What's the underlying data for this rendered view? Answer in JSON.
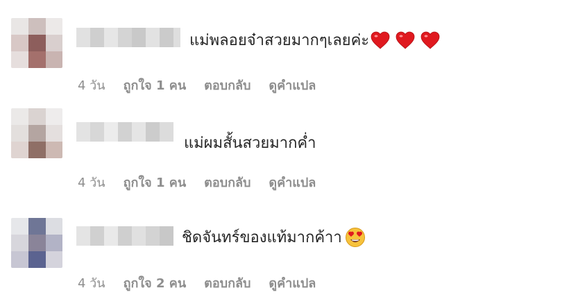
{
  "comments": [
    {
      "text": "แม่พลอยจ๋าสวยมากๆเลยค่ะ",
      "emoji": "heart-icon",
      "emoji_count": 3,
      "time": "4 วัน",
      "likes": "ถูกใจ 1 คน",
      "reply": "ตอบกลับ",
      "translate": "ดูคำแปล"
    },
    {
      "text": "แม่ผมสั้นสวยมากค่ำ",
      "time": "4 วัน",
      "likes": "ถูกใจ 1 คน",
      "reply": "ตอบกลับ",
      "translate": "ดูคำแปล"
    },
    {
      "text": "ชิดจันทร์ของแท้มากค้าา",
      "emoji": "love-eyes-icon",
      "time": "4 วัน",
      "likes": "ถูกใจ 2 คน",
      "reply": "ตอบกลับ",
      "translate": "ดูคำแปล"
    }
  ],
  "colors": {
    "text": "#262626",
    "meta": "#8e8e8e",
    "heart": "#e0191f"
  }
}
